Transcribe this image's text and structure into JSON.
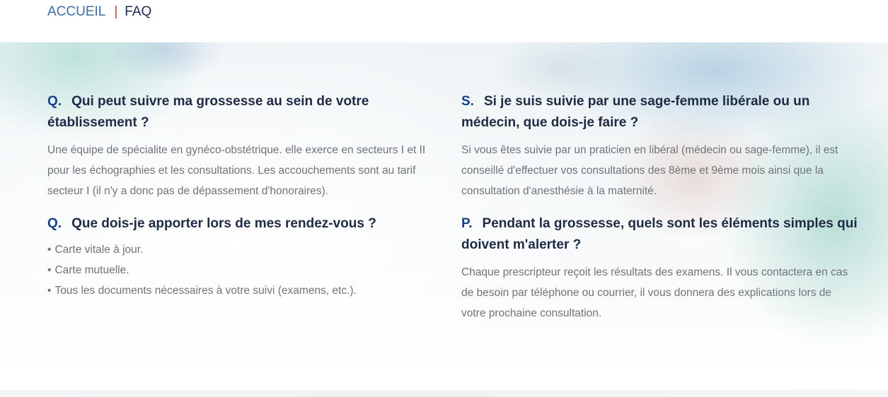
{
  "breadcrumb": {
    "home": "ACCUEIL",
    "separator": "|",
    "current": "FAQ"
  },
  "colors": {
    "question_prefix": "#153f8f",
    "separator": "#d0342c",
    "home_link": "#3d6fa6"
  },
  "faq_left": [
    {
      "prefix": "Q.",
      "question": "Qui peut suivre ma grossesse au sein de votre établissement ?",
      "answer": "Une équipe de spécialite en gynéco-obstétrique. elle exerce en secteurs I et II pour les échographies et les consultations. Les accouchements sont au tarif secteur I (il n'y a donc pas de dépassement d'honoraires)."
    },
    {
      "prefix": "Q.",
      "question": "Que dois-je apporter lors de mes rendez-vous ?",
      "bullet": "•",
      "list": [
        "Carte vitale à jour.",
        "Carte mutuelle.",
        "Tous les documents nécessaires à votre suivi (examens, etc.)."
      ]
    }
  ],
  "faq_right": [
    {
      "prefix": "S.",
      "question": "Si je suis suivie par une sage-femme libérale ou un médecin, que dois-je faire ?",
      "answer": "Si vous êtes suivie par un praticien en libéral (médecin ou sage-femme), il est conseillé d'effectuer vos consultations des 8ème et 9ème mois ainsi que la consultation d'anesthésie à la maternité."
    },
    {
      "prefix": "P.",
      "question": "Pendant la grossesse, quels sont les éléments simples qui doivent m'alerter ?",
      "answer": "Chaque prescripteur reçoit les résultats des examens. Il vous contactera en cas de besoin par téléphone ou courrier, il vous donnera des explications lors de votre prochaine consultation."
    }
  ]
}
